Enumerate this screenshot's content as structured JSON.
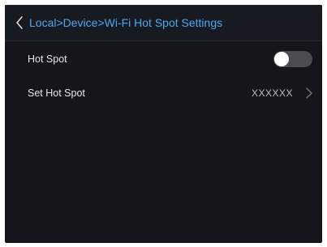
{
  "header": {
    "breadcrumb": "Local>Device>Wi-Fi Hot Spot Settings"
  },
  "settings": [
    {
      "label": "Hot Spot",
      "type": "toggle",
      "enabled": false
    },
    {
      "label": "Set Hot Spot",
      "type": "link",
      "value": "XXXXXX"
    }
  ],
  "colors": {
    "accent": "#4aa8f0",
    "background": "#15161b",
    "toggle_off": "#4a4c52"
  },
  "icons": {
    "back": "chevron-left-icon",
    "forward": "chevron-right-icon"
  }
}
